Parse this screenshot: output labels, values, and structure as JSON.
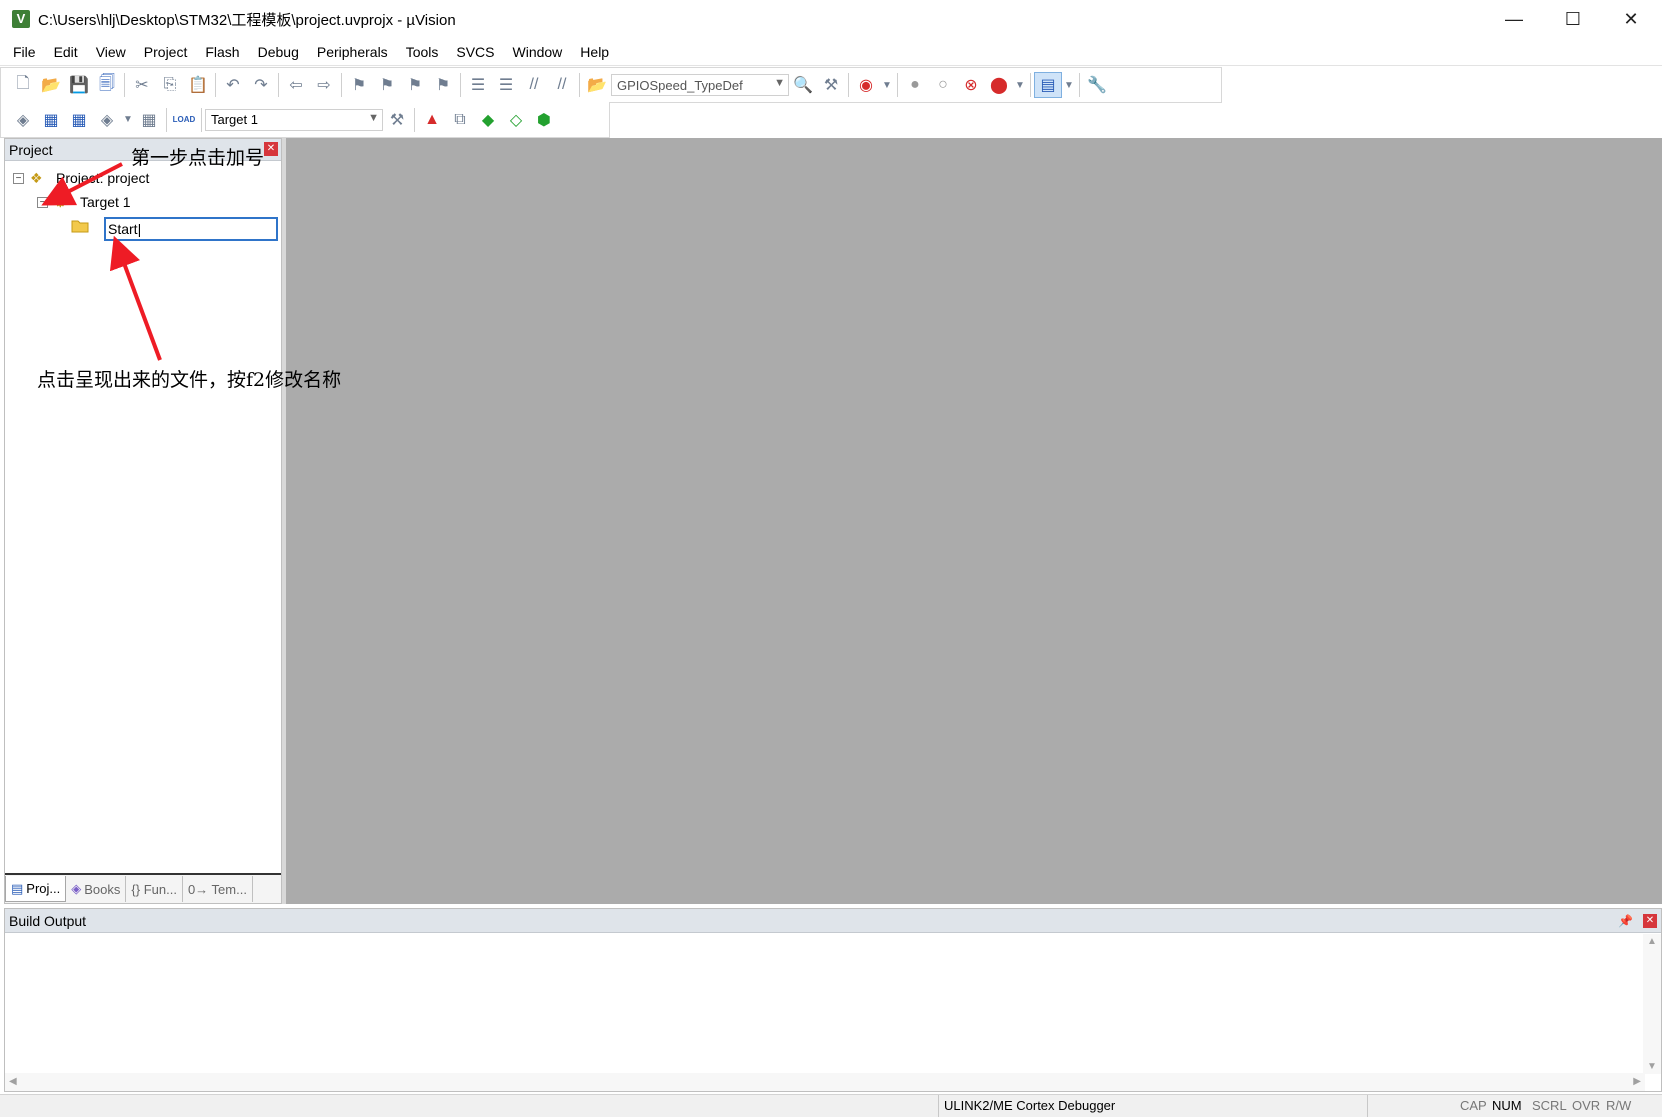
{
  "window": {
    "title": "C:\\Users\\hlj\\Desktop\\STM32\\工程模板\\project.uvprojx - µVision",
    "minimize_glyph": "—",
    "maximize_glyph": "☐",
    "close_glyph": "✕"
  },
  "menu": [
    "File",
    "Edit",
    "View",
    "Project",
    "Flash",
    "Debug",
    "Peripherals",
    "Tools",
    "SVCS",
    "Window",
    "Help"
  ],
  "toolbar": {
    "find_combo_value": "GPIOSpeed_TypeDef",
    "target_combo_value": "Target 1",
    "load_label": "LOAD"
  },
  "project_panel": {
    "header": "Project",
    "tree": {
      "root": "Project: project",
      "target": "Target 1",
      "group_editing": "Start"
    },
    "tabs": [
      "Proj...",
      "Books",
      "{} Fun...",
      "0→ Tem..."
    ]
  },
  "build_output": {
    "header": "Build Output"
  },
  "status_bar": {
    "debugger": "ULINK2/ME Cortex Debugger",
    "cap": "CAP",
    "num": "NUM",
    "scrl": "SCRL",
    "ovr": "OVR",
    "rw": "R/W"
  },
  "annotations": {
    "step1": "第一步点击加号",
    "step2": "点击呈现出来的文件，按f2修改名称"
  },
  "accent_colors": {
    "annotation_arrow": "#ee1c25",
    "editor_background": "#ababab",
    "selection_border": "#2f74c9"
  }
}
